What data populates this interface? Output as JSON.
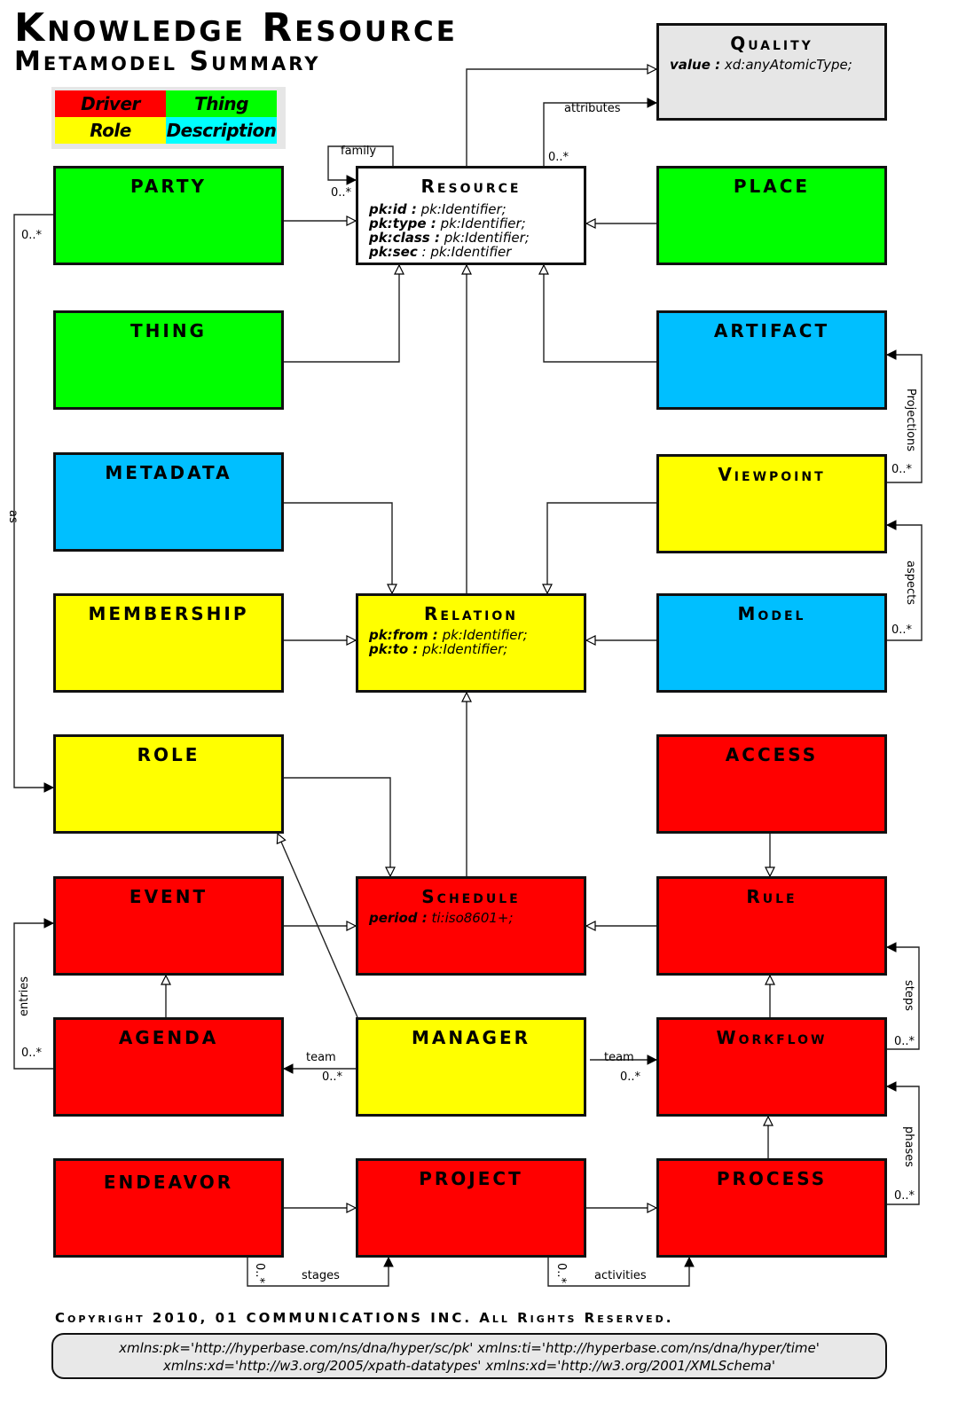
{
  "header": {
    "title": "Knowledge Resource",
    "subtitle": "Metamodel Summary"
  },
  "legend": {
    "items": [
      {
        "label": "Driver",
        "color": "#ff0000"
      },
      {
        "label": "Thing",
        "color": "#00ff00"
      },
      {
        "label": "Role",
        "color": "#ffff00"
      },
      {
        "label": "Description",
        "color": "#00ffff"
      }
    ]
  },
  "colors": {
    "driver": "#ff0000",
    "thing": "#00ff00",
    "role": "#ffff00",
    "description": "#00bfff",
    "core": "#ffffff",
    "quality": "#e6e6e6"
  },
  "classes": {
    "quality": {
      "name": "Quality",
      "attrs": [
        {
          "key": "value :",
          "type": "xd:anyAtomicType;"
        }
      ]
    },
    "resource": {
      "name": "Resource",
      "attrs": [
        {
          "key": "pk:id :",
          "type": "pk:Identifier;"
        },
        {
          "key": "pk:type :",
          "type": "pk:Identifier;"
        },
        {
          "key": "pk:class :",
          "type": "pk:Identifier;"
        },
        {
          "key": "pk:sec",
          "type": ": pk:Identifier"
        }
      ]
    },
    "party": {
      "name": "PARTY"
    },
    "place": {
      "name": "PLACE"
    },
    "thing": {
      "name": "THING"
    },
    "artifact": {
      "name": "ARTIFACT"
    },
    "metadata": {
      "name": "METADATA"
    },
    "viewpoint": {
      "name": "Viewpoint"
    },
    "membership": {
      "name": "MEMBERSHIP"
    },
    "relation": {
      "name": "Relation",
      "attrs": [
        {
          "key": "pk:from :",
          "type": "pk:Identifier;"
        },
        {
          "key": "pk:to :",
          "type": "pk:Identifier;"
        }
      ]
    },
    "model": {
      "name": "Model"
    },
    "role": {
      "name": "ROLE"
    },
    "access": {
      "name": "ACCESS"
    },
    "event": {
      "name": "EVENT"
    },
    "schedule": {
      "name": "Schedule",
      "attrs": [
        {
          "key": "period :",
          "type": "ti:iso8601+;"
        }
      ]
    },
    "rule": {
      "name": "Rule"
    },
    "agenda": {
      "name": "AGENDA"
    },
    "manager": {
      "name": "MANAGER"
    },
    "workflow": {
      "name": "Workflow"
    },
    "endeavor": {
      "name": "ENDEAVOR"
    },
    "project": {
      "name": "PROJECT"
    },
    "process": {
      "name": "PROCESS"
    }
  },
  "associations": {
    "family": "family",
    "family_mult": "0..*",
    "attributes": "attributes",
    "attributes_mult": "0..*",
    "as": "as",
    "as_mult": "0..*",
    "projections": "Projections",
    "projections_mult": "0..*",
    "aspects": "aspects",
    "aspects_mult": "0..*",
    "entries": "entries",
    "entries_mult": "0..*",
    "team_left": "team",
    "team_left_mult": "0..*",
    "team_right": "team",
    "team_right_mult": "0..*",
    "steps": "steps",
    "steps_mult": "0..*",
    "phases": "phases",
    "phases_mult": "0..*",
    "stages": "stages",
    "stages_mult": "0..*",
    "activities": "activities",
    "activities_mult": "0..*"
  },
  "footer": {
    "copyright": "Copyright 2010, 01 COMMUNICATIONS INC. All Rights Reserved.",
    "ns_line1": "xmlns:pk='http://hyperbase.com/ns/dna/hyper/sc/pk' xmlns:ti='http://hyperbase.com/ns/dna/hyper/time'",
    "ns_line2": "xmlns:xd='http://w3.org/2005/xpath-datatypes' xmlns:xd='http://w3.org/2001/XMLSchema'"
  }
}
